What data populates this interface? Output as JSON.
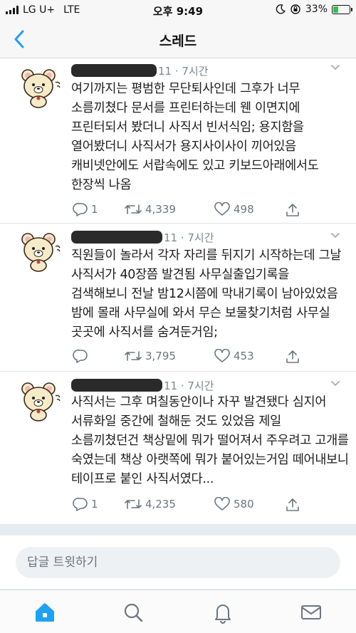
{
  "status_bar": {
    "carrier": "LG U+",
    "network": "LTE",
    "time": "오후 9:49",
    "battery_percent": "33%",
    "battery_level": 0.33
  },
  "header": {
    "title": "스레드"
  },
  "tweets": [
    {
      "meta": "11 · 7시간",
      "text": "여기까지는 평범한 무단퇴사인데 그후가 너무 소름끼쳤다 문서를 프린터하는데 웬 이면지에 프린터되서 봤더니 사직서 빈서식임; 용지함을 열어봤더니 사직서가 용지사이사이 끼어있음 캐비넷안에도 서랍속에도 있고 키보드아래에서도 한장씩 나옴",
      "replies": "1",
      "retweets": "4,339",
      "likes": "498"
    },
    {
      "meta": "11 · 7시간",
      "text": "직원들이 놀라서 각자 자리를 뒤지기 시작하는데 그날 사직서가 40장쯤 발견됨 사무실출입기록을 검색해보니 전날 밤12시쯤에 막내기록이 남아있었음 밤에 몰래 사무실에 와서 무슨 보물찾기처럼 사무실 곳곳에 사직서를 숨겨둔거임;",
      "replies": "",
      "retweets": "3,795",
      "likes": "453"
    },
    {
      "meta": "11 · 7시간",
      "text": "사직서는 그후 며칠동안이나 자꾸 발견됐다 심지어 서류화일 중간에 철해둔 것도 있었음 제일 소름끼쳤던건 책상밑에 뭐가 떨어져서 주우려고 고개를 숙였는데 책상 아랫쪽에 뭐가 붙어있는거임 떼어내보니 테이프로 붙인 사직서였다...",
      "replies": "1",
      "retweets": "4,235",
      "likes": "580"
    }
  ],
  "reply": {
    "placeholder": "답글 트윗하기"
  },
  "colors": {
    "accent": "#1da1f2",
    "icon_gray": "#6a7680",
    "battery_green": "#2fc24a"
  },
  "icons": {
    "back": "chevron-left-icon",
    "reply": "reply-icon",
    "retweet": "retweet-icon",
    "like": "heart-icon",
    "share": "share-icon",
    "home": "home-icon",
    "search": "search-icon",
    "notifications": "bell-icon",
    "messages": "mail-icon"
  }
}
